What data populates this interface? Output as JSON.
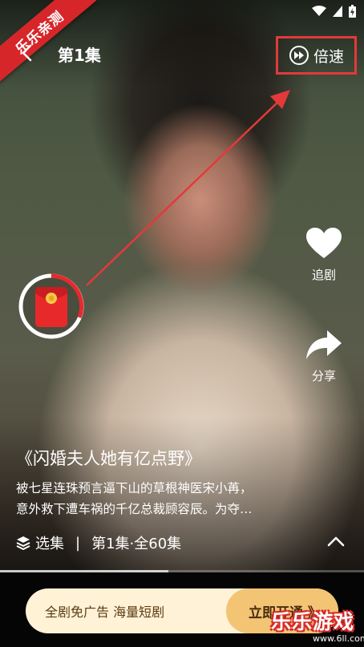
{
  "corner_banner": {
    "text": "乐乐亲测"
  },
  "header": {
    "episode_title": "第1集",
    "speed_label": "倍速"
  },
  "side_actions": [
    {
      "label": "追剧",
      "icon": "heart-icon"
    },
    {
      "label": "分享",
      "icon": "share-icon"
    }
  ],
  "drama": {
    "title": "《闪婚夫人她有亿点野》",
    "synopsis_lines": [
      "被七星连珠预言逼下山的草根神医宋小苒，",
      "意外救下遭车祸的千亿总裁顾容辰。为夺…"
    ]
  },
  "episode_bar": {
    "select_label": "选集",
    "separator": "|",
    "progress_label": "第1集·全60集"
  },
  "promo": {
    "text": "全剧免广告 海量短剧",
    "cta": "立即开通 》"
  },
  "watermark": {
    "brand": "乐乐游戏",
    "url": "www.6ll.com"
  },
  "colors": {
    "accent_red": "#e23a3a",
    "promo_bg": "#fff2d6",
    "promo_cta": "#f3c474"
  }
}
